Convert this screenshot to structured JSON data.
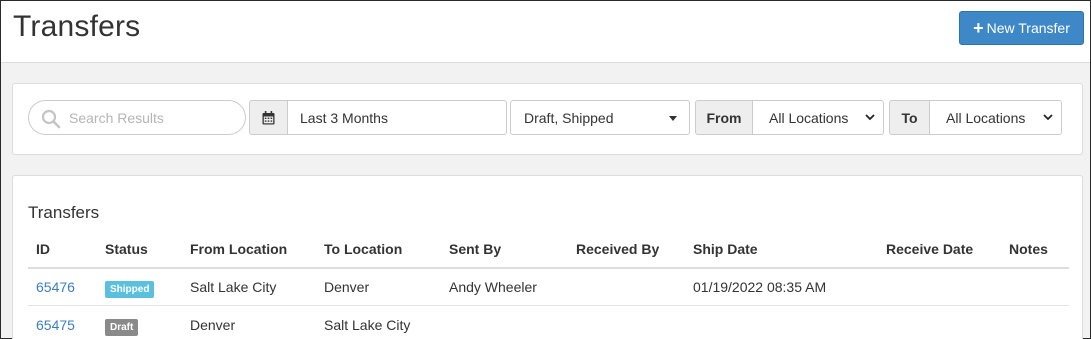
{
  "header": {
    "title": "Transfers",
    "new_button_label": "New Transfer",
    "new_button_icon": "plus-icon"
  },
  "filters": {
    "search": {
      "placeholder": "Search Results",
      "value": "",
      "icon": "search-icon"
    },
    "date_range": {
      "icon": "calendar-icon",
      "value": "Last 3 Months"
    },
    "status": {
      "value": "Draft, Shipped"
    },
    "from": {
      "label": "From",
      "value": "All Locations"
    },
    "to": {
      "label": "To",
      "value": "All Locations"
    }
  },
  "table": {
    "title": "Transfers",
    "columns": [
      "ID",
      "Status",
      "From Location",
      "To Location",
      "Sent By",
      "Received By",
      "Ship Date",
      "Receive Date",
      "Notes"
    ],
    "rows": [
      {
        "id": "65476",
        "status": "Shipped",
        "status_color": "#5bc0de",
        "from": "Salt Lake City",
        "to": "Denver",
        "sent_by": "Andy Wheeler",
        "received_by": "",
        "ship_date": "01/19/2022 08:35 AM",
        "receive_date": "",
        "notes": ""
      },
      {
        "id": "65475",
        "status": "Draft",
        "status_color": "#8a8a8a",
        "from": "Denver",
        "to": "Salt Lake City",
        "sent_by": "",
        "received_by": "",
        "ship_date": "",
        "receive_date": "",
        "notes": ""
      }
    ]
  },
  "colors": {
    "accent": "#3f88c8",
    "link": "#3a7fc1"
  }
}
